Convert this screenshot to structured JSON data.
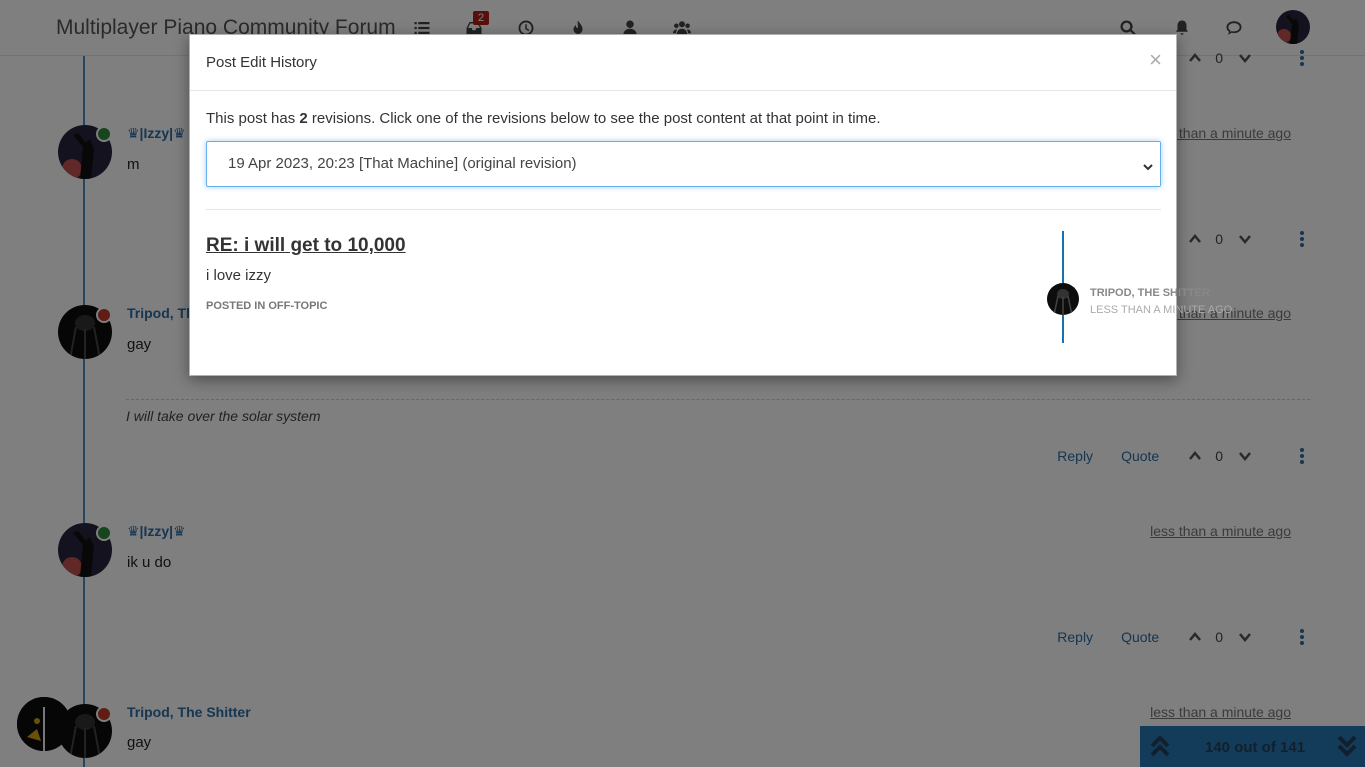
{
  "nav": {
    "brand": "Multiplayer Piano Community Forum",
    "unread_count": "2",
    "icons": [
      "categories-icon",
      "inbox-icon",
      "recent-icon",
      "popular-icon",
      "users-icon",
      "groups-icon",
      "search-icon",
      "notifications-icon",
      "chat-icon"
    ]
  },
  "posts": [
    {
      "author": "♛|Izzy|♛",
      "time": "less than a minute ago",
      "content": "m",
      "votes": "0",
      "status": "online"
    },
    {
      "author": "Tripod, The Shitter",
      "time": "less than a minute ago",
      "content": "gay",
      "signature": "I will take over the solar system",
      "votes": "0",
      "status": "dnd"
    },
    {
      "author": "♛|Izzy|♛",
      "time": "less than a minute ago",
      "content": "ik u do",
      "votes": "0",
      "status": "online"
    },
    {
      "author": "Tripod, The Shitter",
      "time": "less than a minute ago",
      "content": "gay",
      "status": "dnd"
    }
  ],
  "top_votes": "0",
  "actions": {
    "reply": "Reply",
    "quote": "Quote"
  },
  "modal": {
    "title": "Post Edit History",
    "close": "×",
    "intro_pre": "This post has ",
    "intro_count": "2",
    "intro_post": " revisions. Click one of the revisions below to see the post content at that point in time.",
    "selected_revision": "19 Apr 2023, 20:23 [That Machine] (original revision)",
    "preview": {
      "title": "RE: i will get to 10,000",
      "content": "i love izzy",
      "category_label": "Posted in",
      "category": "Off-Topic",
      "author": "Tripod, The Shitter",
      "time": "less than a minute ago"
    }
  },
  "pagination": {
    "label": "140 out of 141"
  },
  "colors": {
    "accent": "#1b71b0",
    "online": "#2c8a3d",
    "dnd": "#c0392b",
    "badge": "#b3211b"
  }
}
